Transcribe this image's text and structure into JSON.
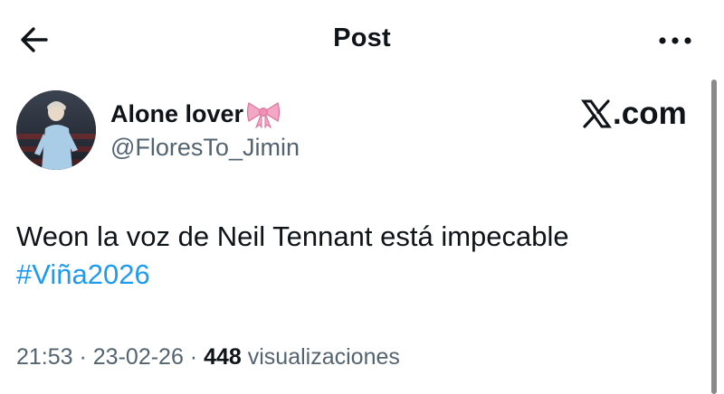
{
  "header": {
    "title": "Post",
    "back_icon": "arrow-left-icon",
    "more_icon": "more-horizontal-icon"
  },
  "author": {
    "display_name": "Alone lover",
    "name_emoji": "ribbon-bow-icon",
    "handle": "@FloresTo_Jimin"
  },
  "branding": {
    "logo_icon": "x-logo-icon",
    "text": ".com"
  },
  "tweet": {
    "text": "Weon la voz de Neil Tennant está impecable",
    "hashtag": "#Viña2026"
  },
  "meta": {
    "time": "21:53",
    "separator": " · ",
    "date": "23-02-26",
    "views_count": "448",
    "views_label": "visualizaciones"
  },
  "colors": {
    "text": "#0f1419",
    "secondary": "#536471",
    "link": "#1d9bf0",
    "bow": "#f4a7c4"
  }
}
